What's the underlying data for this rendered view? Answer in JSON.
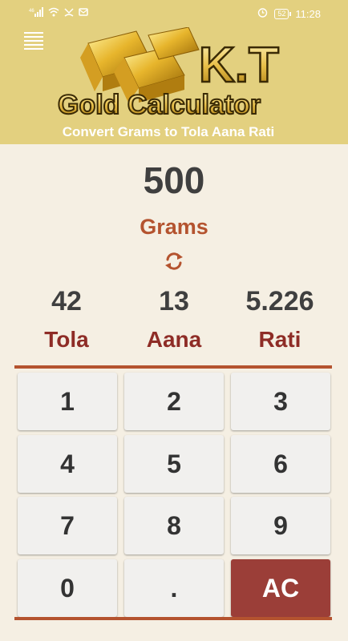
{
  "status_bar": {
    "left_text": "46",
    "battery": "52",
    "time": "11:28"
  },
  "header": {
    "logo_title": "K.T",
    "logo_subtitle": "Gold Calculator",
    "subtitle": "Convert Grams to Tola Aana Rati"
  },
  "input": {
    "value": "500",
    "unit": "Grams"
  },
  "results": [
    {
      "value": "42",
      "label": "Tola"
    },
    {
      "value": "13",
      "label": "Aana"
    },
    {
      "value": "5.226",
      "label": "Rati"
    }
  ],
  "keypad": {
    "keys": [
      "1",
      "2",
      "3",
      "4",
      "5",
      "6",
      "7",
      "8",
      "9",
      "0",
      ".",
      "AC"
    ]
  },
  "colors": {
    "header_bg": "#e3d07f",
    "accent": "#b4532f",
    "label": "#8e2c26",
    "clear_button": "#9b3e38"
  }
}
